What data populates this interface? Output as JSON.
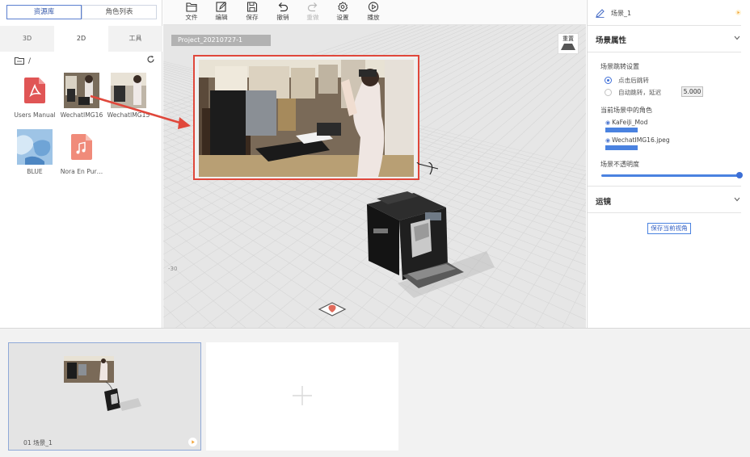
{
  "library": {
    "tabs": [
      {
        "label": "资源库",
        "active": true
      },
      {
        "label": "角色列表",
        "active": false
      }
    ],
    "type_tabs": [
      {
        "label": "3D",
        "active": false
      },
      {
        "label": "2D",
        "active": true
      },
      {
        "label": "工具",
        "active": false
      }
    ],
    "path": "/",
    "assets": [
      {
        "label": "Users Manual",
        "kind": "pdf"
      },
      {
        "label": "WechatIMG16",
        "kind": "photo"
      },
      {
        "label": "WechatIMG15",
        "kind": "photo"
      },
      {
        "label": "BLUE",
        "kind": "image"
      },
      {
        "label": "Nora En Pur…",
        "kind": "audio"
      }
    ]
  },
  "toolbar": {
    "items": [
      {
        "label": "文件",
        "icon": "folder-icon",
        "enabled": true
      },
      {
        "label": "编辑",
        "icon": "edit-icon",
        "enabled": true
      },
      {
        "label": "保存",
        "icon": "save-icon",
        "enabled": true
      },
      {
        "label": "撤销",
        "icon": "undo-icon",
        "enabled": true
      },
      {
        "label": "重做",
        "icon": "redo-icon",
        "enabled": false
      },
      {
        "label": "设置",
        "icon": "gear-icon",
        "enabled": true
      },
      {
        "label": "播放",
        "icon": "play-icon",
        "enabled": true
      }
    ]
  },
  "viewport": {
    "project_name": "Project_20210727-1",
    "reset_label": "重置",
    "axis_label": "-30"
  },
  "properties": {
    "scene_name": "场景_1",
    "section_title": "场景属性",
    "jump_settings_title": "场景跳转设置",
    "jump_options": [
      {
        "label": "点击后跳转",
        "selected": true
      },
      {
        "label": "自动跳转，延迟",
        "selected": false
      }
    ],
    "delay_value": "5.000",
    "roles_title": "当前场景中的角色",
    "roles": [
      "KaFeiJi_Mod",
      "WechatIMG16.jpeg"
    ],
    "opacity_title": "场景不透明度",
    "opacity": 1.0,
    "camera_title": "运镜",
    "save_view_label": "保存当前视角"
  },
  "timeline": {
    "scenes": [
      {
        "label": "01  场景_1"
      }
    ]
  },
  "colors": {
    "accent": "#3f6fd8",
    "highlight": "#e0473b",
    "pdf": "#e05555",
    "audio": "#f08b7a"
  }
}
